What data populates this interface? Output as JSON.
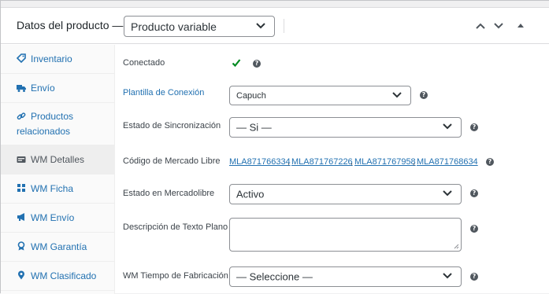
{
  "header": {
    "title": "Datos del producto —",
    "product_type": "Producto variable"
  },
  "sidebar": {
    "items": [
      {
        "label": "Inventario"
      },
      {
        "label": "Envío"
      },
      {
        "label_line1": "Productos",
        "label_line2": "relacionados"
      },
      {
        "label": "WM Detalles"
      },
      {
        "label": "WM Ficha"
      },
      {
        "label": "WM Envío"
      },
      {
        "label": "WM Garantía"
      },
      {
        "label": "WM Clasificado"
      }
    ]
  },
  "fields": {
    "conectado_label": "Conectado",
    "plantilla_label": "Plantilla de Conexión",
    "plantilla_value": "Capuch",
    "sincronizacion_label": "Estado de Sincronización",
    "sincronizacion_value": "— Si —",
    "codigo_label": "Código de Mercado Libre",
    "codigos": [
      "MLA871766334",
      "MLA871767226",
      "MLA871767958",
      "MLA871768634"
    ],
    "estado_label": "Estado en Mercadolibre",
    "estado_value": "Activo",
    "descripcion_label": "Descripción de Texto Plano",
    "tiempo_label": "WM Tiempo de Fabricación",
    "tiempo_value": "— Seleccione —"
  },
  "colors": {
    "link": "#2271b1",
    "check": "#008a20"
  },
  "icons": [
    "check-icon",
    "help-icon",
    "chevron-down-icon",
    "arrow-up-icon",
    "arrow-down-icon",
    "toggle-triangle-icon"
  ]
}
